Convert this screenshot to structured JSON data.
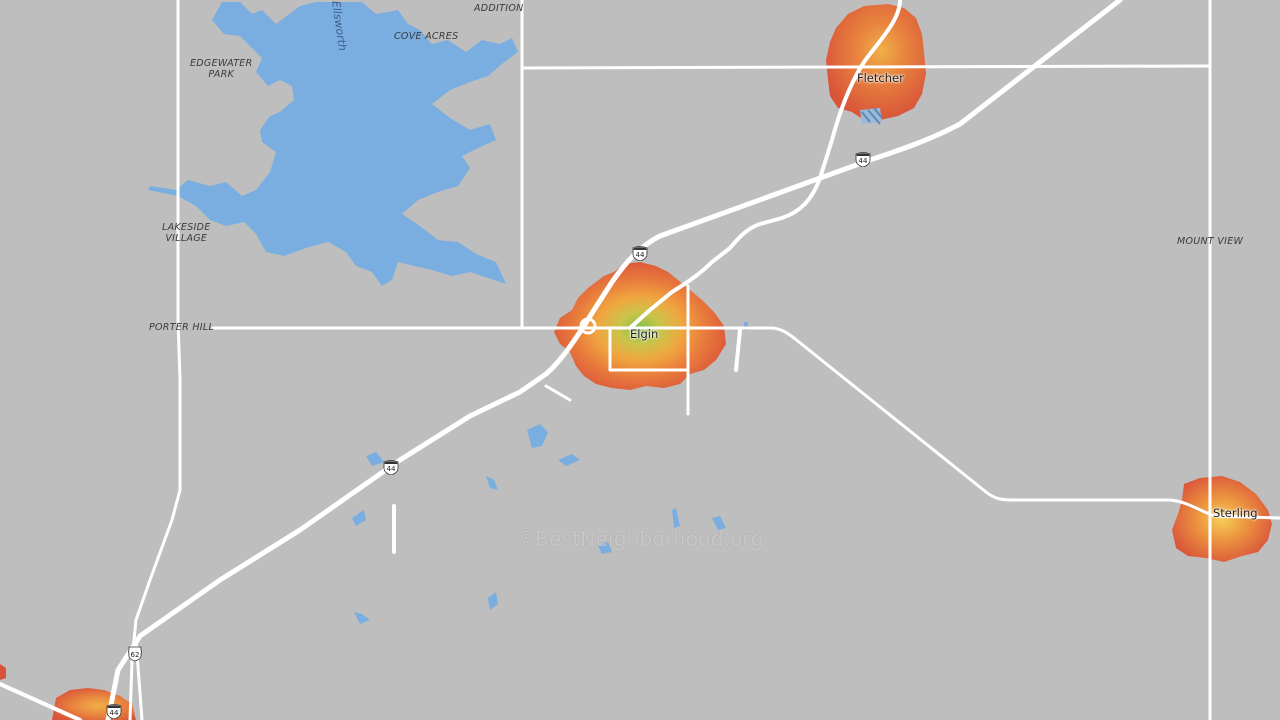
{
  "map": {
    "background_color": "#bebebe",
    "water_color": "#7aaee0",
    "road_color": "#ffffff",
    "heat_colors": [
      "#d9533a",
      "#e87a3c",
      "#f0a640",
      "#e6c24a",
      "#9cc54a"
    ]
  },
  "labels": {
    "edgewater_park": "EDGEWATER\nPARK",
    "cove_acres": "COVE ACRES",
    "addition": "ADDITION",
    "lakeside_village": "LAKESIDE\nVILLAGE",
    "porter_hill": "PORTER HILL",
    "mount_view": "MOUNT VIEW",
    "lake_name": "Ellsworth"
  },
  "towns": {
    "fletcher": "Fletcher",
    "elgin": "Elgin",
    "sterling": "Sterling"
  },
  "shields": {
    "i44_top": "44",
    "i44_mid": "44",
    "i44_low": "44",
    "i44_bottom": "44",
    "us62": "62"
  },
  "watermark": "©BestNeighborhood.org"
}
